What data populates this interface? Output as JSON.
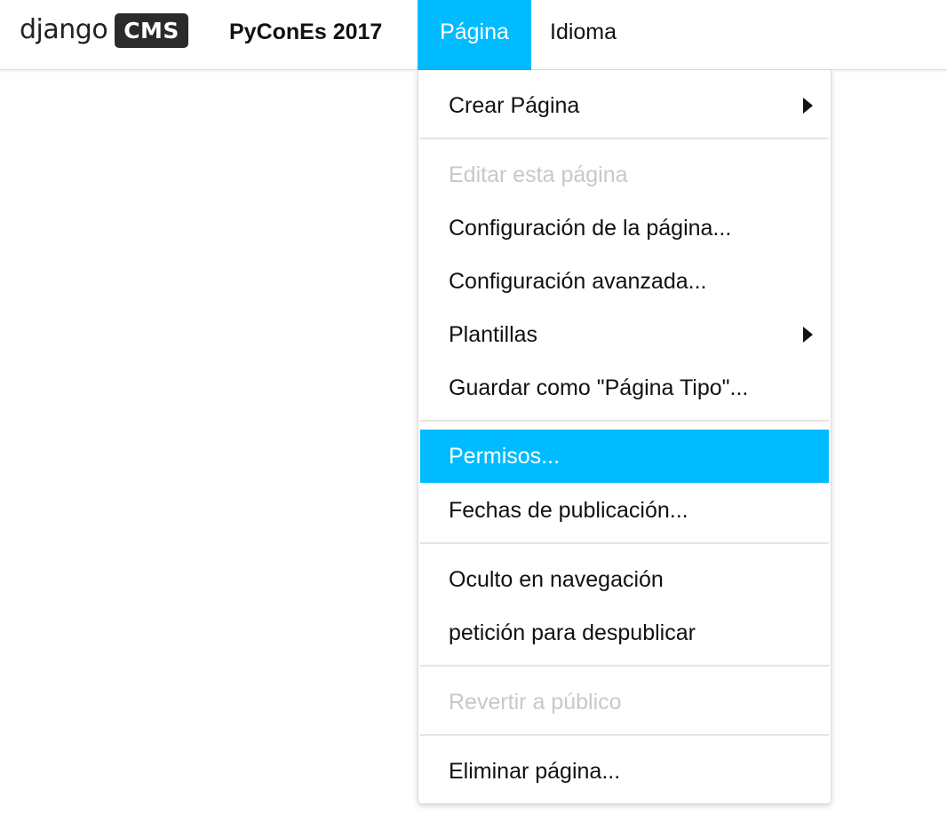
{
  "toolbar": {
    "logo_text": "django",
    "logo_badge": "CMS",
    "site_name": "PyConEs 2017",
    "menus": [
      {
        "label": "Página",
        "active": true
      },
      {
        "label": "Idioma",
        "active": false
      }
    ]
  },
  "page_menu": {
    "items": [
      {
        "label": "Crear Página",
        "has_submenu": true
      },
      {
        "label": "Editar esta página",
        "disabled": true
      },
      {
        "label": "Configuración de la página..."
      },
      {
        "label": "Configuración avanzada..."
      },
      {
        "label": "Plantillas",
        "has_submenu": true
      },
      {
        "label": "Guardar como \"Página Tipo\"..."
      },
      {
        "label": "Permisos...",
        "highlighted": true
      },
      {
        "label": "Fechas de publicación..."
      },
      {
        "label": "Oculto en navegación"
      },
      {
        "label": "petición para despublicar"
      },
      {
        "label": "Revertir a público",
        "disabled": true
      },
      {
        "label": "Eliminar página..."
      }
    ]
  },
  "colors": {
    "accent": "#00bbff",
    "text": "#111111",
    "disabled_text": "#c8c8c8",
    "logo_badge_bg": "#2b2b2b",
    "separator": "#e4e4e4"
  },
  "icons": {
    "submenu": "caret-right-icon"
  }
}
